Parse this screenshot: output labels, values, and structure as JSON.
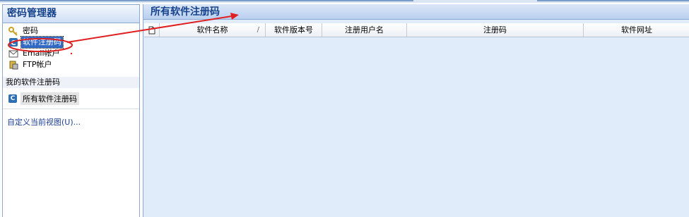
{
  "sidebar": {
    "title": "密码管理器",
    "items": [
      {
        "label": "密码",
        "icon": "key-icon",
        "selected": false
      },
      {
        "label": "软件注册码",
        "icon": "software-key-icon",
        "selected": true
      },
      {
        "label": "Email帐户",
        "icon": "email-account-icon",
        "selected": false
      },
      {
        "label": "FTP帐户",
        "icon": "ftp-account-icon",
        "selected": false
      }
    ],
    "group_header": "我的软件注册码",
    "group_item": {
      "badge": "C",
      "label": "所有软件注册码"
    },
    "custom_view": "自定义当前视图(U)..."
  },
  "main": {
    "title": "所有软件注册码",
    "columns": [
      {
        "label": "",
        "icon": "attachment-icon"
      },
      {
        "label": "软件名称",
        "sort": "/"
      },
      {
        "label": "软件版本号"
      },
      {
        "label": "注册用户名"
      },
      {
        "label": "注册码"
      },
      {
        "label": "软件网址"
      }
    ]
  },
  "colors": {
    "accent": "#15428b",
    "selection": "#316ac5",
    "annotation": "#e02020",
    "pane_bg": "#e1ecfb"
  }
}
